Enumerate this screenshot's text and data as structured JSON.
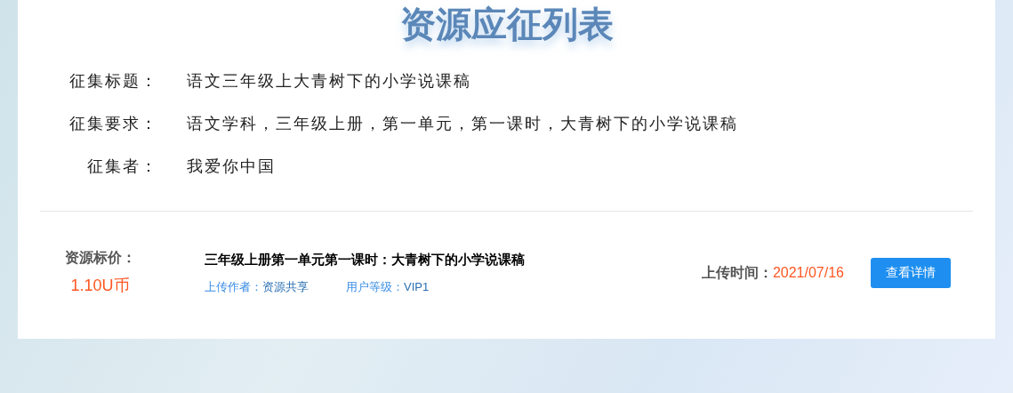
{
  "title": "资源应征列表",
  "fields": [
    {
      "label": "征集标题：",
      "value": "语文三年级上大青树下的小学说课稿"
    },
    {
      "label": "征集要求：",
      "value": "语文学科，三年级上册，第一单元，第一课时，大青树下的小学说课稿"
    },
    {
      "label": "征集者：",
      "value": "我爱你中国"
    }
  ],
  "resource": {
    "price_label": "资源标价：",
    "price": "1.10U币",
    "title": "三年级上册第一单元第一课时：大青树下的小学说课稿",
    "author_label": "上传作者：",
    "author": "资源共享",
    "level_label": "用户等级：",
    "level": "VIP1",
    "time_label": "上传时间：",
    "time": "2021/07/16",
    "button": "查看详情"
  }
}
